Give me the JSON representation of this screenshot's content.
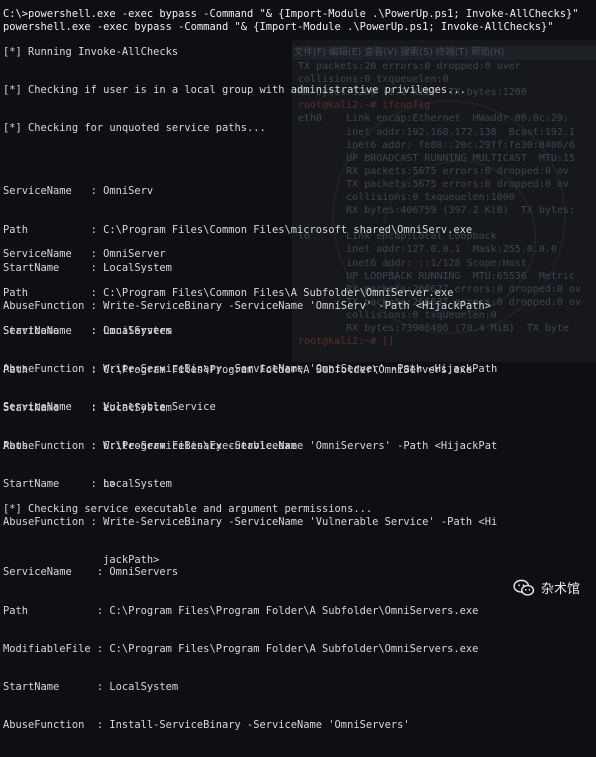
{
  "background_terminal": {
    "menu": "文件(F) 编辑(E) 查看(V) 搜索(S) 终端(T) 帮助(H)",
    "lines": [
      "TX packets:20 errors:0 dropped:0 over",
      "collisions:0 txqueuelen:0",
      "RX bytes:1200 (1.1 KiB)  TX bytes:1200",
      "root@kali2:~# ifconfig",
      "eth0    Link encap:Ethernet  HWaddr 00:0c:29:",
      "        inet addr:192.168.172.138  Bcast:192.1",
      "        inet6 addr: fe80::20c:29ff:fe30:8406/6",
      "        UP BROADCAST RUNNING MULTICAST  MTU:15",
      "        RX packets:5675 errors:0 dropped:0 ov",
      "        TX packets:5675 errors:0 dropped:0 ov",
      "        collisions:0 txqueuelen:1000",
      "        RX bytes:406759 (397.2 KiB)  TX bytes:",
      "",
      "lo      Link encap:Local Loopback",
      "        inet addr:127.0.0.1  Mask:255.0.0.0",
      "        inet6 addr: ::1/128 Scope:Host",
      "        UP LOOPBACK RUNNING  MTU:65536  Metric",
      "        RX packets:266637 errors:0 dropped:0 ov",
      "        TX packets:266637 errors:0 dropped:0 ov",
      "        collisions:0 txqueuelen:0",
      "        RX bytes:73906406 (70.4 MiB)  TX byte",
      "root@kali2:~# []"
    ]
  },
  "terminal": {
    "command_echo": "C:\\>powershell.exe -exec bypass -Command \"& {Import-Module .\\PowerUp.ps1; Invoke-AllChecks}\"",
    "command_repeat": "powershell.exe -exec bypass -Command \"& {Import-Module .\\PowerUp.ps1; Invoke-AllChecks}\"",
    "running": "[*] Running Invoke-AllChecks",
    "check_admin": "[*] Checking if user is in a local group with administrative privileges...",
    "check_unquoted": "[*] Checking for unquoted service paths...",
    "block1": [
      "ServiceName   : OmniServ",
      "Path          : C:\\Program Files\\Common Files\\microsoft shared\\OmniServ.exe",
      "StartName     : LocalSystem",
      "AbuseFunction : Write-ServiceBinary -ServiceName 'OmniServ' -Path <HijackPath>"
    ],
    "block2": [
      "ServiceName   : OmniServer",
      "Path          : C:\\Program Files\\Common Files\\A Subfolder\\OmniServer.exe",
      "StartName     : LocalSystem",
      "AbuseFunction : Write-ServiceBinary -ServiceName 'OmniServer' -Path <HijackPath",
      "                >"
    ],
    "block3": [
      "ServiceName   : OmniServers",
      "Path          : C:\\Program Files\\Program Folder\\A Subfolder\\OmniServers.exe",
      "StartName     : LocalSystem",
      "AbuseFunction : Write-ServiceBinary -ServiceName 'OmniServers' -Path <HijackPat",
      "                h>"
    ],
    "block4": [
      "ServiceName   : Vulnerable Service",
      "Path          : C:\\Program Files\\Executable.exe",
      "StartName     : LocalSystem",
      "AbuseFunction : Write-ServiceBinary -ServiceName 'Vulnerable Service' -Path <Hi",
      "                jackPath>"
    ],
    "check_perms": "[*] Checking service executable and argument permissions...",
    "block5": [
      "ServiceName    : OmniServers",
      "Path           : C:\\Program Files\\Program Folder\\A Subfolder\\OmniServers.exe",
      "ModifiableFile : C:\\Program Files\\Program Folder\\A Subfolder\\OmniServers.exe",
      "StartName      : LocalSystem",
      "AbuseFunction  : Install-ServiceBinary -ServiceName 'OmniServers'"
    ]
  },
  "watermark": {
    "text": "杂术馆",
    "icon": "wechat-icon"
  }
}
